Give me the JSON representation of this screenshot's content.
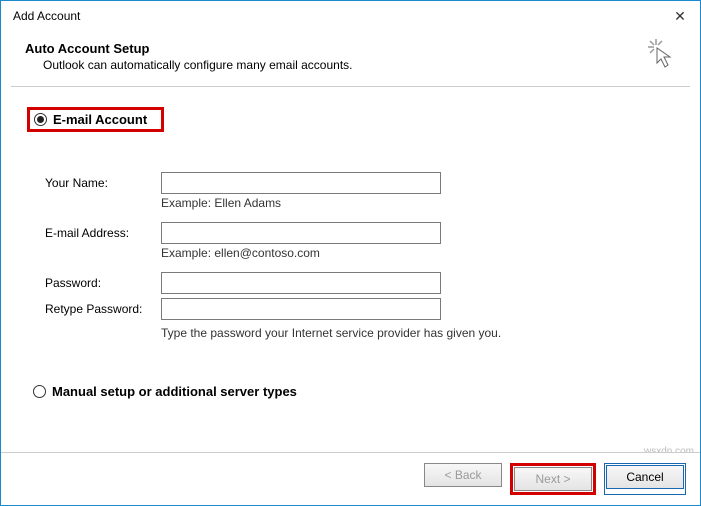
{
  "titlebar": {
    "title": "Add Account",
    "close": "✕"
  },
  "header": {
    "title": "Auto Account Setup",
    "subtitle": "Outlook can automatically configure many email accounts."
  },
  "options": {
    "email_account": "E-mail Account",
    "manual_setup": "Manual setup or additional server types"
  },
  "form": {
    "your_name_label": "Your Name:",
    "your_name_value": "",
    "your_name_example": "Example: Ellen Adams",
    "email_label": "E-mail Address:",
    "email_value": "",
    "email_example": "Example: ellen@contoso.com",
    "password_label": "Password:",
    "password_value": "",
    "retype_label": "Retype Password:",
    "retype_value": "",
    "password_hint": "Type the password your Internet service provider has given you."
  },
  "footer": {
    "back": "< Back",
    "next": "Next >",
    "cancel": "Cancel"
  },
  "watermark": "wsxdn.com"
}
